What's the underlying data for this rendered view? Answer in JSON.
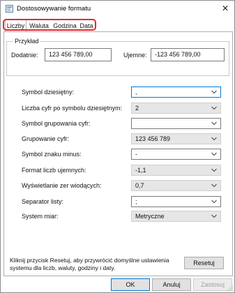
{
  "window": {
    "title": "Dostosowywanie formatu",
    "close_glyph": "✕"
  },
  "tabs": [
    {
      "label": "Liczby",
      "active": true
    },
    {
      "label": "Waluta",
      "active": false
    },
    {
      "label": "Godzina",
      "active": false
    },
    {
      "label": "Data",
      "active": false
    }
  ],
  "highlight_color": "#e02a2a",
  "accent_color": "#0078d7",
  "example": {
    "legend": "Przykład",
    "positive_label": "Dodatnie:",
    "positive_value": "123 456 789,00",
    "negative_label": "Ujemne:",
    "negative_value": "-123 456 789,00"
  },
  "settings": [
    {
      "label": "Symbol dziesiętny:",
      "value": ",",
      "kind": "editable",
      "focused": true
    },
    {
      "label": "Liczba cyfr po symbolu dziesiętnym:",
      "value": "2",
      "kind": "dropdown"
    },
    {
      "label": "Symbol grupowania cyfr:",
      "value": "",
      "kind": "editable"
    },
    {
      "label": "Grupowanie cyfr:",
      "value": "123 456 789",
      "kind": "dropdown"
    },
    {
      "label": "Symbol znaku minus:",
      "value": "-",
      "kind": "editable"
    },
    {
      "label": "Format liczb ujemnych:",
      "value": "-1,1",
      "kind": "dropdown"
    },
    {
      "label": "Wyświetlanie zer wiodących:",
      "value": "0,7",
      "kind": "dropdown"
    },
    {
      "label": "Separator listy:",
      "value": ";",
      "kind": "editable"
    },
    {
      "label": "System miar:",
      "value": "Metryczne",
      "kind": "dropdown"
    }
  ],
  "footer": {
    "note": "Kliknij przycisk Resetuj, aby przywrócić domyślne ustawienia systemu dla liczb, waluty, godziny i daty.",
    "reset_label": "Resetuj"
  },
  "buttons": {
    "ok": "OK",
    "cancel": "Anuluj",
    "apply": "Zastosuj"
  }
}
